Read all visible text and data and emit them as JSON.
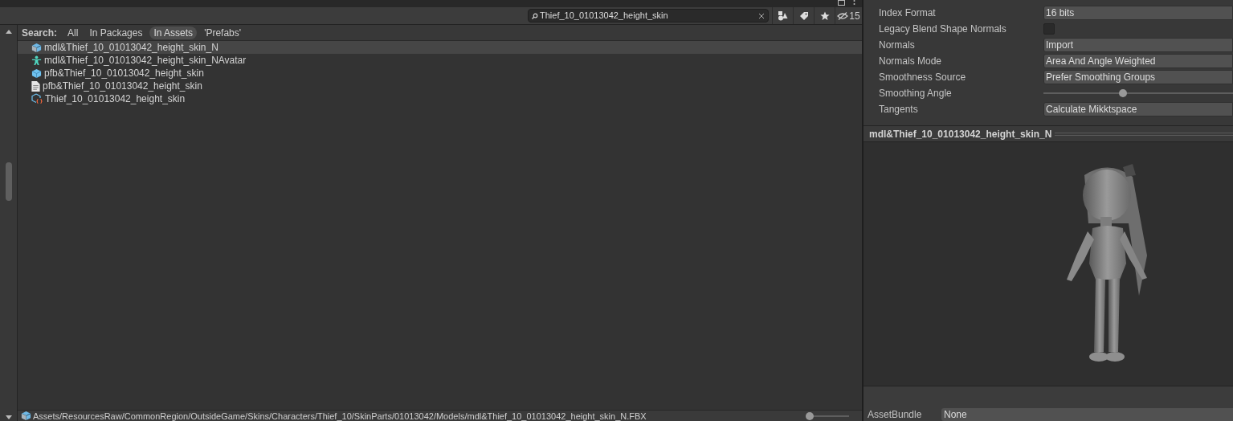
{
  "toolbar": {
    "search": {
      "value": "Thief_10_01013042_height_skin"
    },
    "hidden_count": "15"
  },
  "search_scope": {
    "label": "Search:",
    "tabs": [
      {
        "label": "All",
        "selected": false
      },
      {
        "label": "In Packages",
        "selected": false
      },
      {
        "label": "In Assets",
        "selected": true
      },
      {
        "label": "'Prefabs'",
        "selected": false
      }
    ]
  },
  "results": [
    {
      "name": "mdl&Thief_10_01013042_height_skin_N",
      "kind": "model",
      "selected": true
    },
    {
      "name": "mdl&Thief_10_01013042_height_skin_NAvatar",
      "kind": "avatar",
      "selected": false
    },
    {
      "name": "pfb&Thief_10_01013042_height_skin",
      "kind": "prefab",
      "selected": false
    },
    {
      "name": "pfb&Thief_10_01013042_height_skin",
      "kind": "file",
      "selected": false
    },
    {
      "name": "Thief_10_01013042_height_skin",
      "kind": "variant",
      "selected": false
    }
  ],
  "status_bar": {
    "path": "Assets/ResourcesRaw/CommonRegion/OutsideGame/Skins/Characters/Thief_10/SkinParts/01013042/Models/mdl&Thief_10_01013042_height_skin_N.FBX",
    "zoom": {
      "level": 0.08
    }
  },
  "inspector": {
    "properties": [
      {
        "label": "Index Format",
        "kind": "dropdown",
        "value": "16 bits"
      },
      {
        "label": "Legacy Blend Shape Normals",
        "kind": "checkbox",
        "checked": false
      },
      {
        "label": "Normals",
        "kind": "dropdown",
        "value": "Import"
      },
      {
        "label": "Normals Mode",
        "kind": "dropdown",
        "value": "Area And Angle Weighted"
      },
      {
        "label": "Smoothness Source",
        "kind": "dropdown",
        "value": "Prefer Smoothing Groups"
      },
      {
        "label": "Smoothing Angle",
        "kind": "slider",
        "level": 0.42
      },
      {
        "label": "Tangents",
        "kind": "dropdown",
        "value": "Calculate Mikktspace"
      }
    ],
    "preview": {
      "title": "mdl&Thief_10_01013042_height_skin_N",
      "kind": "picture"
    },
    "asset_bundle": {
      "label": "AssetBundle",
      "value": "None"
    }
  }
}
